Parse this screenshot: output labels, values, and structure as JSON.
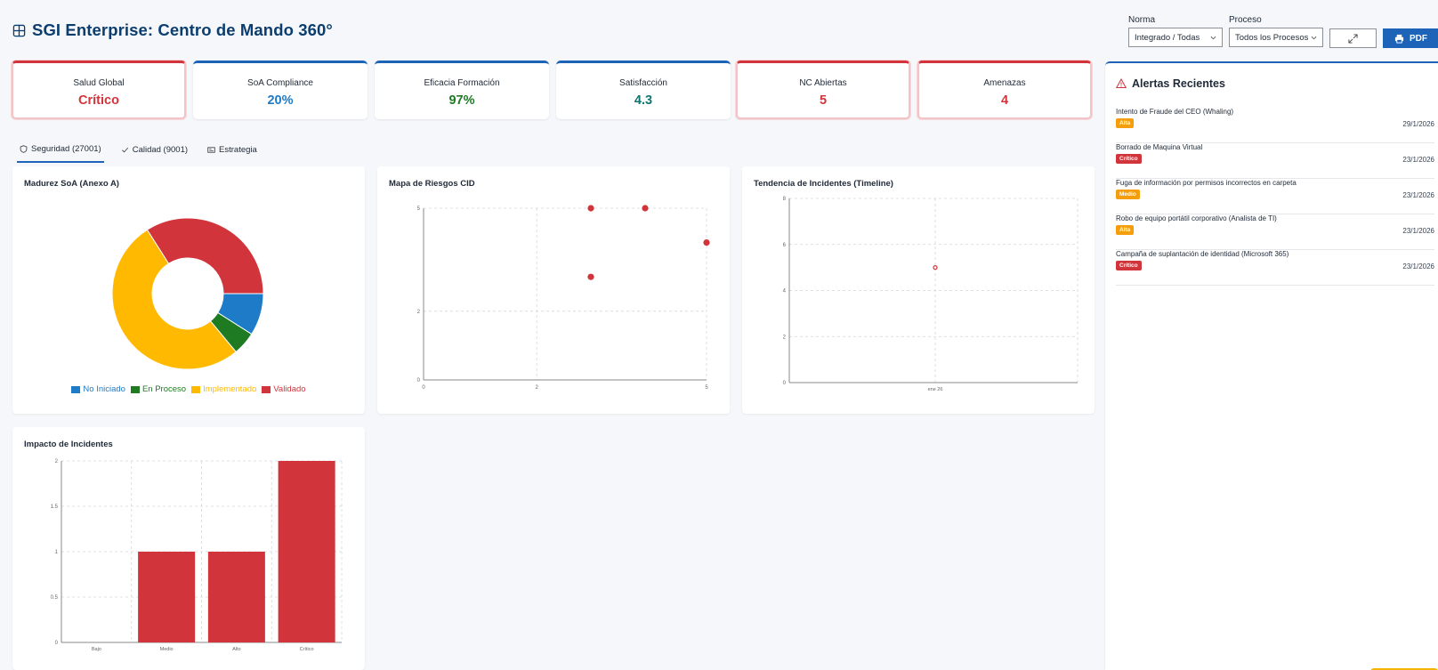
{
  "header": {
    "title": "SGI Enterprise: Centro de Mando 360°",
    "norma_label": "Norma",
    "norma_value": "Integrado / Todas",
    "proceso_label": "Proceso",
    "proceso_value": "Todos los Procesos",
    "pdf_label": "PDF"
  },
  "kpis": [
    {
      "label": "Salud Global",
      "value": "Crítico"
    },
    {
      "label": "SoA Compliance",
      "value": "20%"
    },
    {
      "label": "Eficacia Formación",
      "value": "97%"
    },
    {
      "label": "Satisfacción",
      "value": "4.3"
    },
    {
      "label": "NC Abiertas",
      "value": "5"
    },
    {
      "label": "Amenazas",
      "value": "4"
    }
  ],
  "tabs": [
    {
      "label": "Seguridad (27001)",
      "icon": "shield-icon"
    },
    {
      "label": "Calidad (9001)",
      "icon": "check-icon"
    },
    {
      "label": "Estrategia",
      "icon": "id-card-icon"
    }
  ],
  "colors": {
    "blue": "#1d7bc7",
    "green": "#1e7b22",
    "yellow": "#ffb900",
    "red": "#d1343b"
  },
  "panels": {
    "soa_title": "Madurez SoA (Anexo A)",
    "riesgos_title": "Mapa de Riesgos CID",
    "tendencia_title": "Tendencia de Incidentes (Timeline)",
    "impacto_title": "Impacto de Incidentes"
  },
  "chart_data": [
    {
      "type": "pie",
      "title": "Madurez SoA (Anexo A)",
      "labels": [
        "No Iniciado",
        "En Proceso",
        "Implementado",
        "Validado"
      ],
      "values": [
        9,
        5,
        52,
        34
      ],
      "colors": [
        "#1d7bc7",
        "#1e7b22",
        "#ffb900",
        "#d1343b"
      ],
      "legend": "bottom"
    },
    {
      "type": "scatter",
      "title": "Mapa de Riesgos CID",
      "x": [
        3,
        4,
        5,
        3
      ],
      "y": [
        5,
        5,
        4,
        3
      ],
      "xlim": [
        0,
        5
      ],
      "ylim": [
        0,
        5
      ],
      "xticks": [
        "0",
        "2",
        "5"
      ],
      "yticks": [
        "0",
        "2",
        "5"
      ],
      "grid": true
    },
    {
      "type": "scatter",
      "title": "Tendencia de Incidentes (Timeline)",
      "x": [
        "ene 26"
      ],
      "y": [
        5
      ],
      "ylim": [
        0,
        8
      ],
      "yticks": [
        "0",
        "2",
        "4",
        "6",
        "8"
      ],
      "xticks": [
        "ene 26"
      ],
      "grid": true
    },
    {
      "type": "bar",
      "title": "Impacto de Incidentes",
      "categories": [
        "Bajo",
        "Medio",
        "Alto",
        "Crítico"
      ],
      "values": [
        0,
        1,
        1,
        2
      ],
      "ylim": [
        0,
        2
      ],
      "yticks": [
        "0",
        "0.5",
        "1",
        "1.5",
        "2"
      ],
      "grid": true
    }
  ],
  "alerts": {
    "title": "Alertas Recientes",
    "items": [
      {
        "title": "Intento de Fraude del CEO (Whaling)",
        "badge": "Alta",
        "date": "29/1/2026"
      },
      {
        "title": "Borrado de Maquina Virtual",
        "badge": "Crítico",
        "date": "23/1/2026"
      },
      {
        "title": "Fuga de información por permisos incorrectos en carpeta",
        "badge": "Medio",
        "date": "23/1/2026"
      },
      {
        "title": "Robo de equipo portátil corporativo (Analista de TI)",
        "badge": "Alta",
        "date": "23/1/2026"
      },
      {
        "title": "Campaña de suplantación de identidad (Microsoft 365)",
        "badge": "Crítico",
        "date": "23/1/2026"
      }
    ]
  }
}
